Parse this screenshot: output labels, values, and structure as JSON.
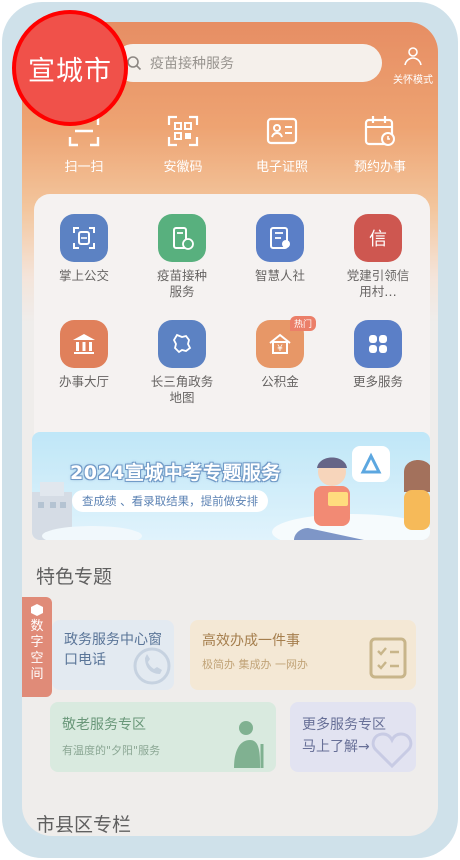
{
  "header": {
    "search_placeholder": "疫苗接种服务",
    "care_mode_label": "关怀模式"
  },
  "quick_actions": [
    {
      "label": "扫一扫",
      "icon": "scan-icon"
    },
    {
      "label": "安徽码",
      "icon": "qr-code-icon"
    },
    {
      "label": "电子证照",
      "icon": "id-card-icon"
    },
    {
      "label": "预约办事",
      "icon": "calendar-icon"
    }
  ],
  "services": [
    {
      "label": "掌上公交",
      "icon": "bus-card-icon",
      "color": "#2f5fb3"
    },
    {
      "label": "疫苗接种服务",
      "icon": "vaccine-icon",
      "color": "#2a9a5a"
    },
    {
      "label": "智慧人社",
      "icon": "certificate-icon",
      "color": "#2d5cb8"
    },
    {
      "label": "党建引领信用村…",
      "icon": "credit-icon",
      "color": "#c0281f"
    },
    {
      "label": "办事大厅",
      "icon": "hall-icon",
      "color": "#d85d2d"
    },
    {
      "label": "长三角政务地图",
      "icon": "map-icon",
      "color": "#2f5fb3"
    },
    {
      "label": "公积金",
      "icon": "fund-icon",
      "color": "#e07a3d",
      "badge": "热门"
    },
    {
      "label": "更多服务",
      "icon": "grid-icon",
      "color": "#2d5cb8"
    }
  ],
  "banner": {
    "title": "2024宣城中考专题服务",
    "subtitle": "查成绩 、看录取结果，提前做安排"
  },
  "featured": {
    "title": "特色专题",
    "cards": [
      {
        "title": "政务服务中心窗口电话",
        "subtitle": "",
        "color": "#dce4ee"
      },
      {
        "title": "高效办成一件事",
        "subtitle": "极简办  集成办  一网办",
        "color": "#f1e2c9"
      },
      {
        "title": "敬老服务专区",
        "subtitle": "有温度的\"夕阳\"服务",
        "color": "#cfe5d7"
      },
      {
        "title": "更多服务专区",
        "subtitle": "马上了解→",
        "color": "#dadcee"
      }
    ]
  },
  "side_tab": {
    "label": "数字空间"
  },
  "county_section": {
    "title": "市县区专栏"
  },
  "city_badge": {
    "label": "宣城市",
    "color": "#f0514a"
  }
}
